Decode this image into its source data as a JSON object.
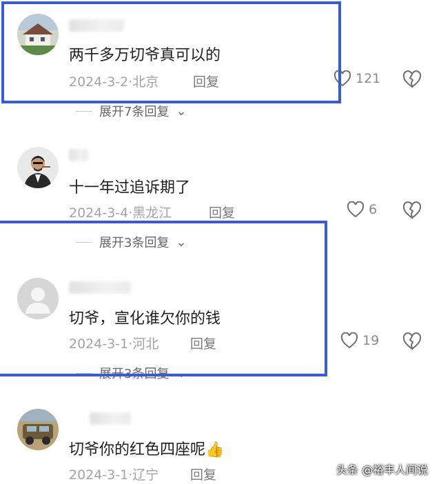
{
  "comments": [
    {
      "text": "两千多万切爷真可以的",
      "date": "2024-3-2",
      "location": "北京",
      "reply_label": "回复",
      "likes": "121",
      "expand": "展开7条回复",
      "avatar_icon": "house-photo-avatar"
    },
    {
      "text": "十一年过追诉期了",
      "date": "2024-3-4",
      "location": "黑龙江",
      "reply_label": "回复",
      "likes": "6",
      "expand": "展开3条回复",
      "avatar_icon": "man-suit-avatar"
    },
    {
      "text": "切爷，宣化谁欠你的钱",
      "date": "2024-3-1",
      "location": "河北",
      "reply_label": "回复",
      "likes": "19",
      "expand": "展开3条回复",
      "avatar_icon": "default-user-avatar"
    },
    {
      "text": "切爷你的红色四座呢",
      "date": "2024-3-1",
      "location": "辽宁",
      "reply_label": "回复",
      "emoji": "👍",
      "avatar_icon": "car-photo-avatar"
    }
  ],
  "separator": "·",
  "watermark": "头条 @裕丰人间说",
  "colors": {
    "highlight": "#3a5bd9",
    "meta_text": "#a3a3a3"
  }
}
